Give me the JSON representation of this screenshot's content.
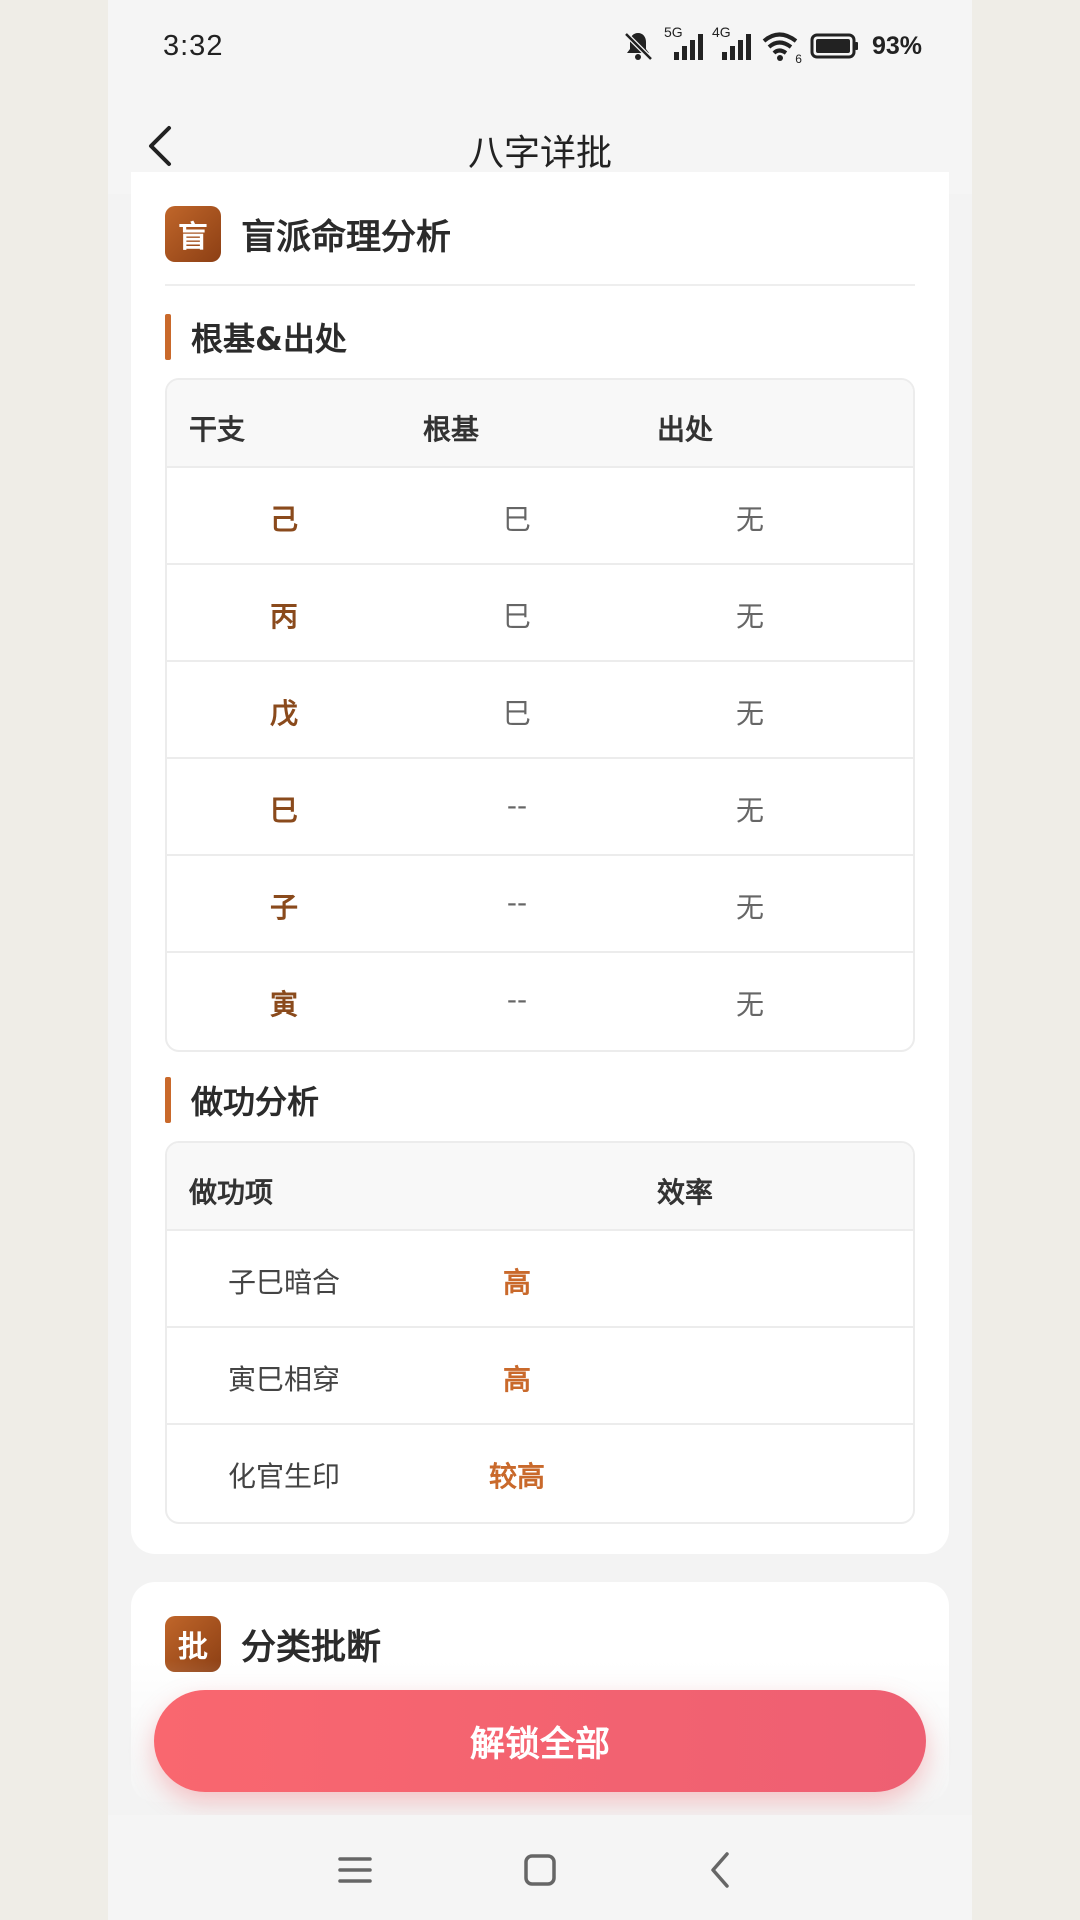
{
  "status_bar": {
    "time": "3:32",
    "signal_5g": "5G",
    "signal_4g": "4G",
    "wifi_level": "6",
    "battery": "93%"
  },
  "nav": {
    "title": "八字详批"
  },
  "section1": {
    "badge": "盲",
    "title": "盲派命理分析",
    "roots": {
      "title": "根基&出处",
      "headers": [
        "干支",
        "根基",
        "出处"
      ],
      "rows": [
        {
          "ganzhi": "己",
          "root": "巳",
          "source": "无"
        },
        {
          "ganzhi": "丙",
          "root": "巳",
          "source": "无"
        },
        {
          "ganzhi": "戊",
          "root": "巳",
          "source": "无"
        },
        {
          "ganzhi": "巳",
          "root": "--",
          "source": "无"
        },
        {
          "ganzhi": "子",
          "root": "--",
          "source": "无"
        },
        {
          "ganzhi": "寅",
          "root": "--",
          "source": "无"
        }
      ]
    },
    "work": {
      "title": "做功分析",
      "headers": [
        "做功项",
        "效率"
      ],
      "rows": [
        {
          "item": "子巳暗合",
          "efficiency": "高"
        },
        {
          "item": "寅巳相穿",
          "efficiency": "高"
        },
        {
          "item": "化官生印",
          "efficiency": "较高"
        }
      ]
    }
  },
  "section2": {
    "badge": "批",
    "title": "分类批断"
  },
  "unlock_button": "解锁全部",
  "colors": {
    "accent": "#c9692b",
    "ganzhi_text": "#8a4a1c",
    "unlock_button": "#f56670"
  }
}
